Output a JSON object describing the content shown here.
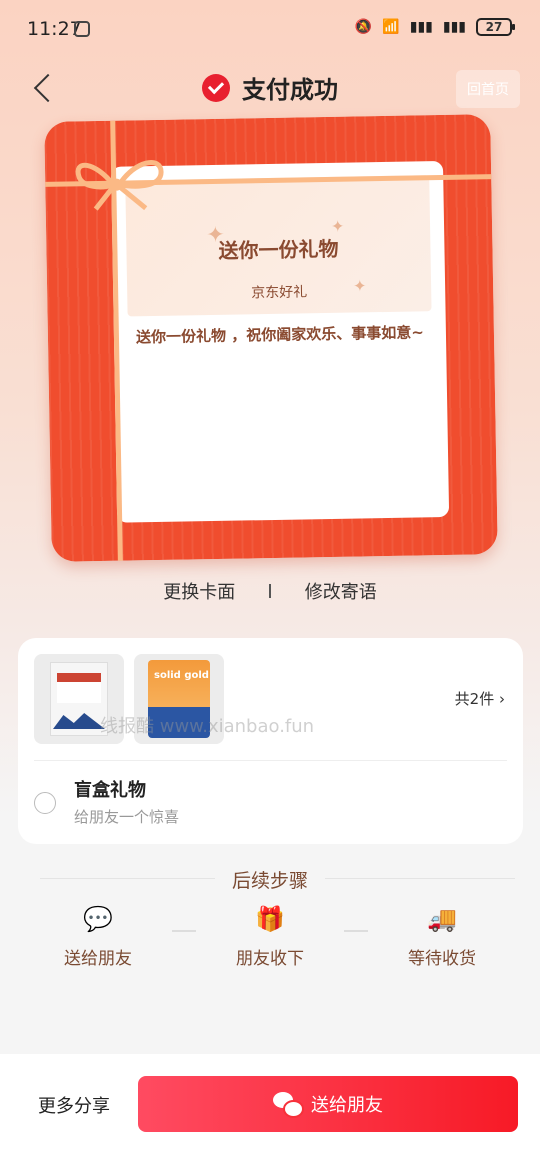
{
  "status_bar": {
    "time": "11:27",
    "battery": "27",
    "signal_label": "6"
  },
  "header": {
    "title": "支付成功",
    "home_label": "回首页"
  },
  "card": {
    "title": "送你一份礼物",
    "subtitle": "京东好礼",
    "message": "送你一份礼物 ，祝你阖家欢乐、事事如意~"
  },
  "card_actions": {
    "change_cover": "更换卡面",
    "edit_message": "修改寄语"
  },
  "products": {
    "total": "共2件",
    "items": [
      "salt",
      "cat-food"
    ],
    "cat_food_brand": "solid gold"
  },
  "blind_box": {
    "title": "盲盒礼物",
    "subtitle": "给朋友一个惊喜"
  },
  "watermark": "线报酷 www.xianbao.fun",
  "steps": {
    "heading": "后续步骤",
    "items": [
      {
        "icon": "wechat-icon",
        "label": "送给朋友"
      },
      {
        "icon": "gift-icon",
        "label": "朋友收下"
      },
      {
        "icon": "truck-icon",
        "label": "等待收货"
      }
    ]
  },
  "bottom_bar": {
    "more_share": "更多分享",
    "send_button": "送给朋友"
  },
  "colors": {
    "accent": "#f71a26",
    "card_red": "#f04d2e",
    "ribbon": "#fbb985",
    "brown_text": "#7a4a32"
  }
}
